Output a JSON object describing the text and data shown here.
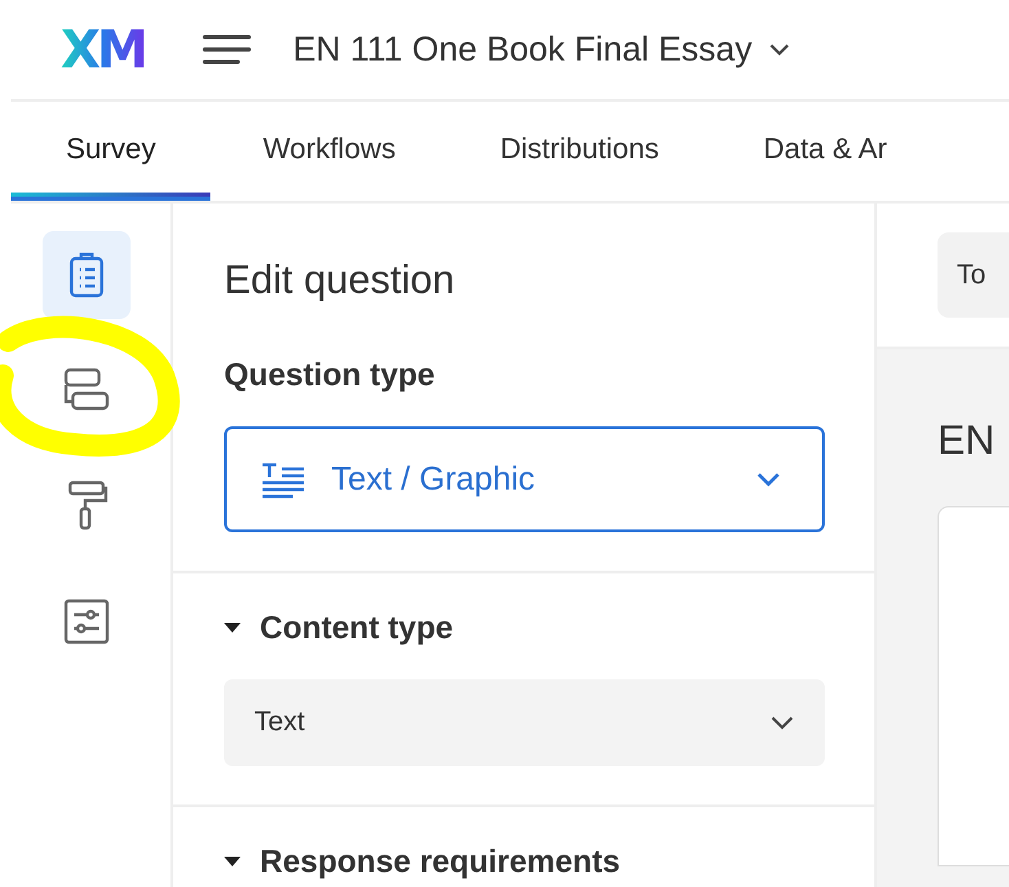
{
  "header": {
    "logo": "XM",
    "survey_title": "EN 111 One Book Final Essay"
  },
  "tabs": [
    {
      "label": "Survey",
      "selected": true
    },
    {
      "label": "Workflows",
      "selected": false
    },
    {
      "label": "Distributions",
      "selected": false
    },
    {
      "label": "Data & Ar",
      "selected": false
    }
  ],
  "rail": [
    {
      "kind": "survey",
      "selected": true
    },
    {
      "kind": "flow",
      "selected": false
    },
    {
      "kind": "look",
      "selected": false
    },
    {
      "kind": "options",
      "selected": false
    }
  ],
  "edit_panel": {
    "title": "Edit question",
    "question_type_label": "Question type",
    "question_type": "Text / Graphic",
    "sections": [
      {
        "title": "Content type",
        "expanded": true,
        "select_value": "Text"
      },
      {
        "title": "Response requirements",
        "expanded": true
      }
    ]
  },
  "preview": {
    "toolbar_button": "To",
    "heading": "EN"
  }
}
